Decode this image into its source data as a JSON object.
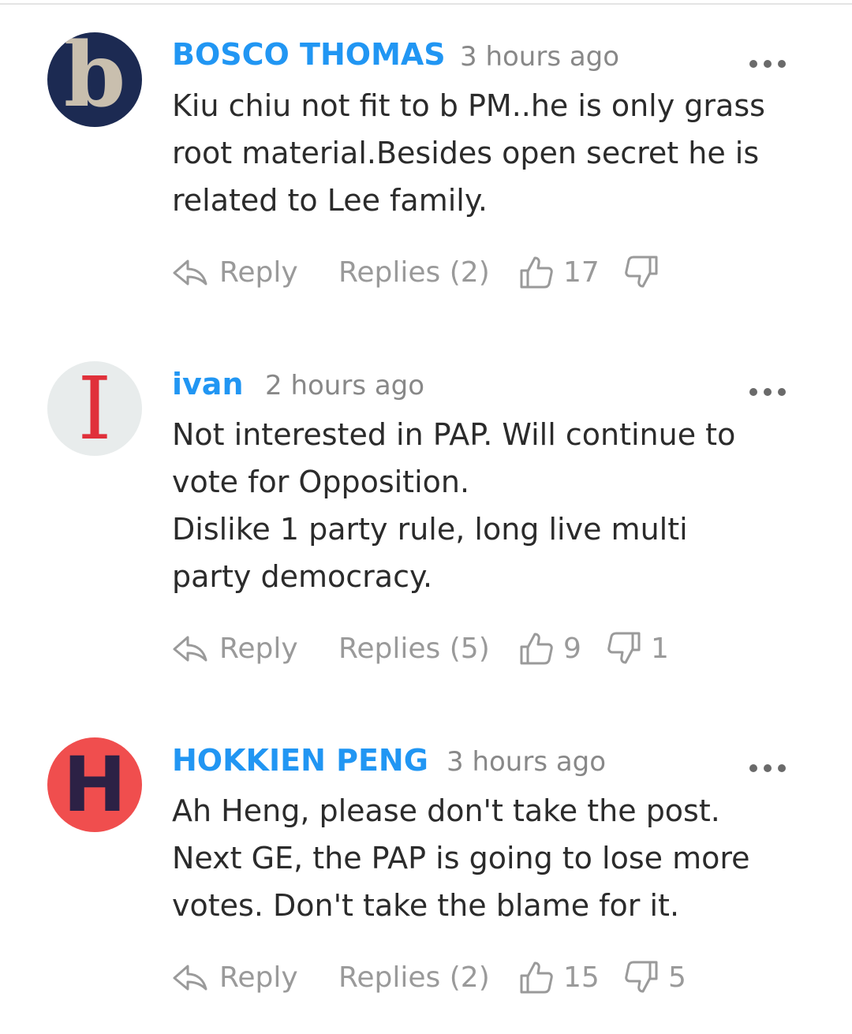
{
  "comments": [
    {
      "author": "BOSCO THOMAS",
      "time": "3 hours ago",
      "avatar_letter": "b",
      "avatar_bg": "#1c2a52",
      "avatar_fg": "#c9bfae",
      "lines": [
        "Kiu chiu not fit to b PM..he is only grass",
        "root material.Besides open secret he is",
        "related to Lee family."
      ],
      "reply_label": "Reply",
      "replies_label": "Replies (2)",
      "likes": "17",
      "dislikes": ""
    },
    {
      "author": "ivan",
      "time": "2 hours ago",
      "avatar_letter": "I",
      "avatar_bg": "#e8ecec",
      "avatar_fg": "#e0303a",
      "lines": [
        "Not interested in PAP. Will continue to",
        "vote for Opposition.",
        "Dislike 1 party rule, long live multi",
        "party democracy."
      ],
      "reply_label": "Reply",
      "replies_label": "Replies (5)",
      "likes": "9",
      "dislikes": "1"
    },
    {
      "author": "HOKKIEN PENG",
      "time": "3 hours ago",
      "avatar_letter": "H",
      "avatar_bg": "#f04e4e",
      "avatar_fg": "#2c2145",
      "lines": [
        "Ah Heng, please don't take the post.",
        "Next GE, the PAP is going to lose more",
        "votes. Don't take the blame for it."
      ],
      "reply_label": "Reply",
      "replies_label": "Replies (2)",
      "likes": "15",
      "dislikes": "5"
    }
  ],
  "icons": {
    "reply": "reply-arrow-icon",
    "more": "more-dots-icon",
    "like": "thumbs-up-icon",
    "dislike": "thumbs-down-icon"
  },
  "colors": {
    "author": "#2196f3",
    "time": "#888888",
    "body": "#2b2b2b",
    "action": "#9a9a9a"
  }
}
